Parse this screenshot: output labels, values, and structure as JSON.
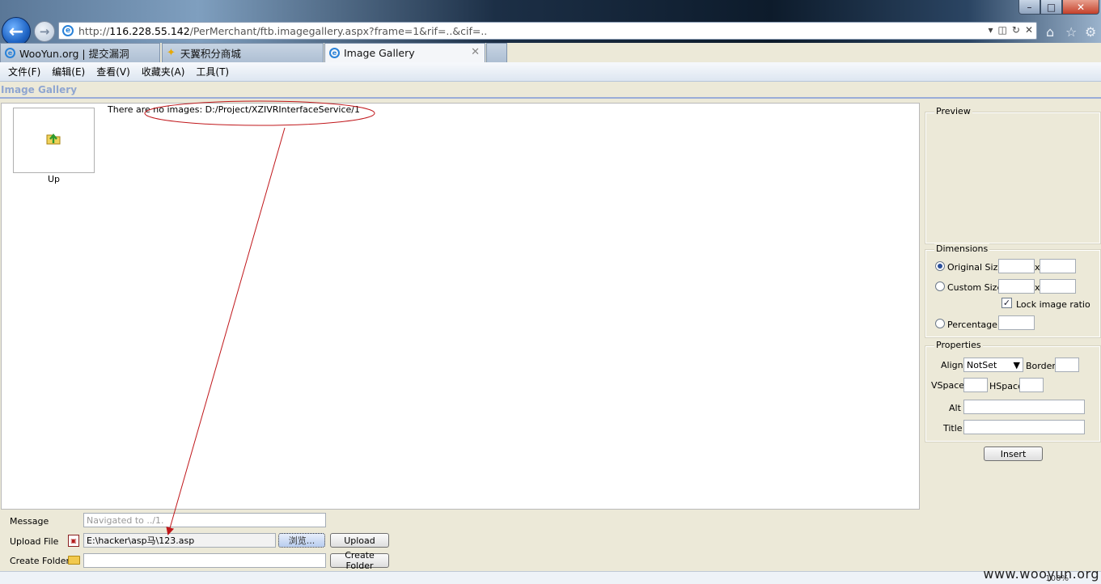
{
  "browser": {
    "url_prefix": "http://",
    "url_host": "116.228.55.142",
    "url_path": "/PerMerchant/ftb.imagegallery.aspx?frame=1&rif=..&cif=..",
    "tabs": [
      {
        "label": "WooYun.org | 提交漏洞",
        "active": false
      },
      {
        "label": "天翼积分商城",
        "active": false
      },
      {
        "label": "Image Gallery",
        "active": true
      }
    ],
    "menu": [
      "文件(F)",
      "编辑(E)",
      "查看(V)",
      "收藏夹(A)",
      "工具(T)"
    ]
  },
  "gallery": {
    "header": "Image Gallery",
    "up_label": "Up",
    "no_images_text": "There are no images: D:/Project/XZIVRInterfaceService/1"
  },
  "preview": {
    "title": "Preview"
  },
  "dimensions": {
    "title": "Dimensions",
    "original_size_label": "Original Size",
    "original_size_selected": true,
    "custom_size_label": "Custom Size",
    "x_sep": "x",
    "lock_ratio_label": "Lock image ratio",
    "lock_ratio_checked": true,
    "percentage_label": "Percentage"
  },
  "properties": {
    "title": "Properties",
    "align_label": "Align",
    "align_value": "NotSet",
    "border_label": "Border",
    "vspace_label": "VSpace",
    "hspace_label": "HSpace",
    "alt_label": "Alt",
    "title_label": "Title",
    "insert_button": "Insert"
  },
  "form": {
    "message_label": "Message",
    "message_value": "Navigated to ../1.",
    "upload_label": "Upload File",
    "upload_value": "E:\\hacker\\asp马\\123.asp",
    "browse_button": "浏览...",
    "upload_button": "Upload",
    "create_folder_label": "Create Folder",
    "create_folder_button": "Create Folder"
  },
  "status": {
    "zoom": "100%",
    "watermark": "www.wooyun.org"
  },
  "colors": {
    "annotation": "#c0171b",
    "header_accent": "#8fa6d1"
  }
}
